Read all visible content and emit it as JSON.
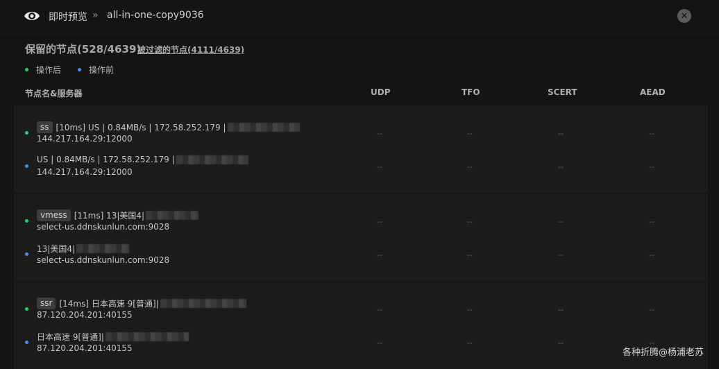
{
  "header": {
    "title": "即时预览",
    "separator": "»",
    "subtitle": "all-in-one-copy9036"
  },
  "summary": {
    "kept_label": "保留的节点(528/4639)",
    "filtered_label": "被过滤的节点(4111/4639)"
  },
  "legend": {
    "after": "操作后",
    "before": "操作前",
    "after_color": "#2ecc71",
    "before_color": "#4a90e2"
  },
  "columns": {
    "name": "节点名&服务器",
    "udp": "UDP",
    "tfo": "TFO",
    "scert": "SCERT",
    "aead": "AEAD"
  },
  "groups": [
    {
      "after": {
        "tag": "ss",
        "name": "[10ms] US | 0.84MB/s | 172.58.252.179 |",
        "server": "144.217.164.29:12000",
        "udp": "--",
        "tfo": "--",
        "scert": "--",
        "aead": "--"
      },
      "before": {
        "name": "US | 0.84MB/s | 172.58.252.179 |",
        "server": "144.217.164.29:12000",
        "udp": "--",
        "tfo": "--",
        "scert": "--",
        "aead": "--"
      }
    },
    {
      "after": {
        "tag": "vmess",
        "name": "[11ms] 13|美国4|",
        "server": "select-us.ddnskunlun.com:9028",
        "udp": "--",
        "tfo": "--",
        "scert": "--",
        "aead": "--"
      },
      "before": {
        "name": "13|美国4|",
        "server": "select-us.ddnskunlun.com:9028",
        "udp": "--",
        "tfo": "--",
        "scert": "--",
        "aead": "--"
      }
    },
    {
      "after": {
        "tag": "ssr",
        "name": "[14ms] 日本高速 9[普通]|",
        "server": "87.120.204.201:40155",
        "udp": "--",
        "tfo": "--",
        "scert": "--",
        "aead": "--"
      },
      "before": {
        "name": "日本高速 9[普通]|",
        "server": "87.120.204.201:40155",
        "udp": "--",
        "tfo": "--",
        "scert": "--",
        "aead": "--"
      }
    }
  ],
  "watermark": "各种折腾@杨浦老苏"
}
